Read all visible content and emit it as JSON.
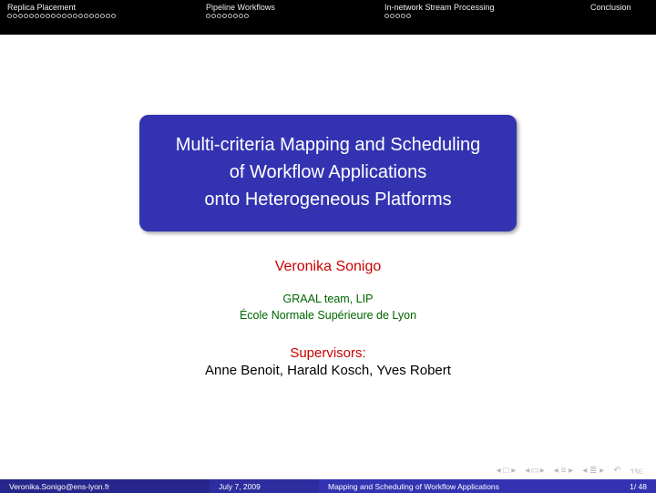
{
  "header": {
    "sections": [
      {
        "label": "Replica Placement",
        "dots": 20
      },
      {
        "label": "Pipeline Workflows",
        "dots": 8
      },
      {
        "label": "In-network Stream Processing",
        "dots": 5
      },
      {
        "label": "Conclusion",
        "dots": 0
      }
    ]
  },
  "title": {
    "line1": "Multi-criteria Mapping and Scheduling",
    "line2": "of Workflow Applications",
    "line3": "onto Heterogeneous Platforms"
  },
  "author": "Veronika Sonigo",
  "affiliation": {
    "line1": "GRAAL team, LIP",
    "line2": "École Normale Supérieure de Lyon"
  },
  "supervisors": {
    "label": "Supervisors:",
    "names": "Anne Benoit, Harald Kosch, Yves Robert"
  },
  "footer": {
    "author": "Veronika.Sonigo@ens-lyon.fr",
    "date": "July 7, 2009",
    "title": "Mapping and Scheduling of Workflow Applications",
    "page": "1/ 48"
  }
}
